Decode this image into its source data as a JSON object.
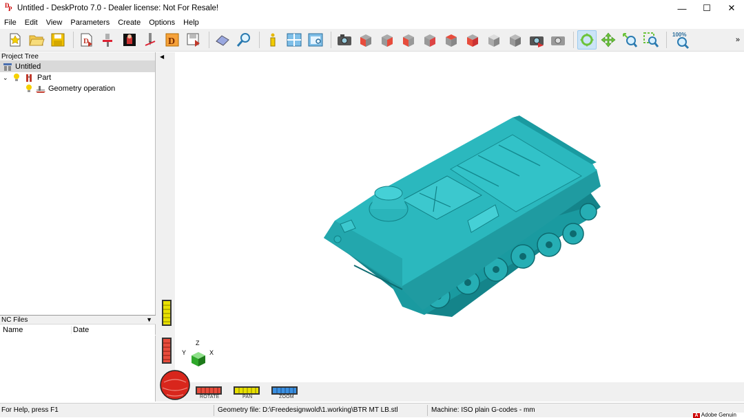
{
  "window": {
    "title": "Untitled - DeskProto 7.0 - Dealer license: Not For Resale!",
    "logo_text": "DP",
    "minimize_glyph": "—",
    "maximize_glyph": "☐",
    "close_glyph": "✕"
  },
  "menu": [
    "File",
    "Edit",
    "View",
    "Parameters",
    "Create",
    "Options",
    "Help"
  ],
  "toolbar": {
    "zoom_level": "100%",
    "more_glyph": "»",
    "icons": [
      "new-project-icon",
      "open-folder-icon",
      "save-icon",
      "import-geometry-icon",
      "machine-icon",
      "material-icon",
      "cutter-icon",
      "part-icon",
      "export-icon",
      "eraser-icon",
      "zoom-search-icon",
      "info-icon",
      "layout-icon",
      "frame-icon",
      "camera-icon",
      "view-front-icon",
      "view-back-icon",
      "view-left-icon",
      "view-right-icon",
      "view-top-icon",
      "view-bottom-icon",
      "view-iso-icon",
      "view-iso-gray-icon",
      "screenshot-icon",
      "screenshot-alt-icon",
      "rotate-mode-icon",
      "pan-mode-icon",
      "zoom-in-icon",
      "zoom-box-icon",
      "zoom-100-icon"
    ]
  },
  "project_tree": {
    "header": "Project Tree",
    "items": [
      {
        "label": "Untitled",
        "level": 0
      },
      {
        "label": "Part",
        "level": 1
      },
      {
        "label": "Geometry operation",
        "level": 2
      }
    ]
  },
  "nc_files": {
    "header": "NC Files",
    "columns": [
      "Name",
      "Date"
    ],
    "rows": []
  },
  "navigator": {
    "rotate_label": "ROTATE",
    "pan_label": "PAN",
    "zoom_label": "ZOOM",
    "axis_x": "X",
    "axis_y": "Y",
    "axis_z": "Z"
  },
  "statusbar": {
    "help": "For Help, press F1",
    "geometry": "Geometry file: D:\\Freedesignwold\\1.working\\BTR MT LB.stl",
    "machine": "Machine: ISO plain G-codes - mm",
    "tray": "Adobe Genuin"
  },
  "colors": {
    "model": "#26aeb4",
    "model_dark": "#14848a",
    "selection": "#d9d9d9"
  }
}
